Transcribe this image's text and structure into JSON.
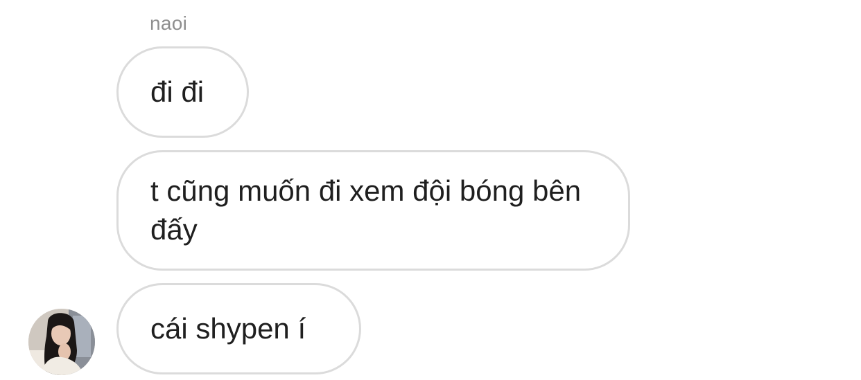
{
  "chat": {
    "sender_name": "naoi",
    "messages": [
      {
        "text": "đi đi"
      },
      {
        "text": "t cũng muốn đi xem đội bóng bên đấy"
      },
      {
        "text": "cái shypen í"
      }
    ]
  },
  "avatar": {
    "icon": "profile-photo"
  }
}
